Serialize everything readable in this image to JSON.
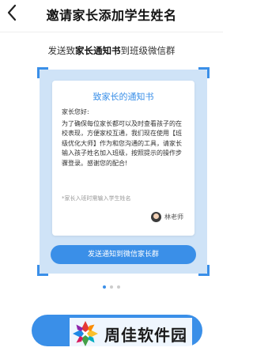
{
  "header": {
    "title": "邀请家长添加学生姓名"
  },
  "instruction": {
    "prefix": "发送致",
    "highlight": "家长通知书",
    "suffix": "到班级微信群"
  },
  "notice": {
    "title": "致家长的通知书",
    "greeting": "家长您好:",
    "body": "为了确保每位家长都可以及时查看孩子的在校表现，方便家校互通，我们现在使用【班级优化大师】作为和您沟通的工具，请家长输入孩子姓名加入班级，按照提示的操作步骤登录。感谢您的配合!",
    "hint": "*家长入班时需输入学生姓名",
    "teacher_name": "林老师",
    "send_button": "发送通知到微信家长群"
  },
  "pagination": {
    "total": 3,
    "active": 1
  },
  "watermark": {
    "text": "周佳软件园"
  },
  "colors": {
    "accent": "#3a8fe8",
    "frame": "#cfe3f7"
  }
}
